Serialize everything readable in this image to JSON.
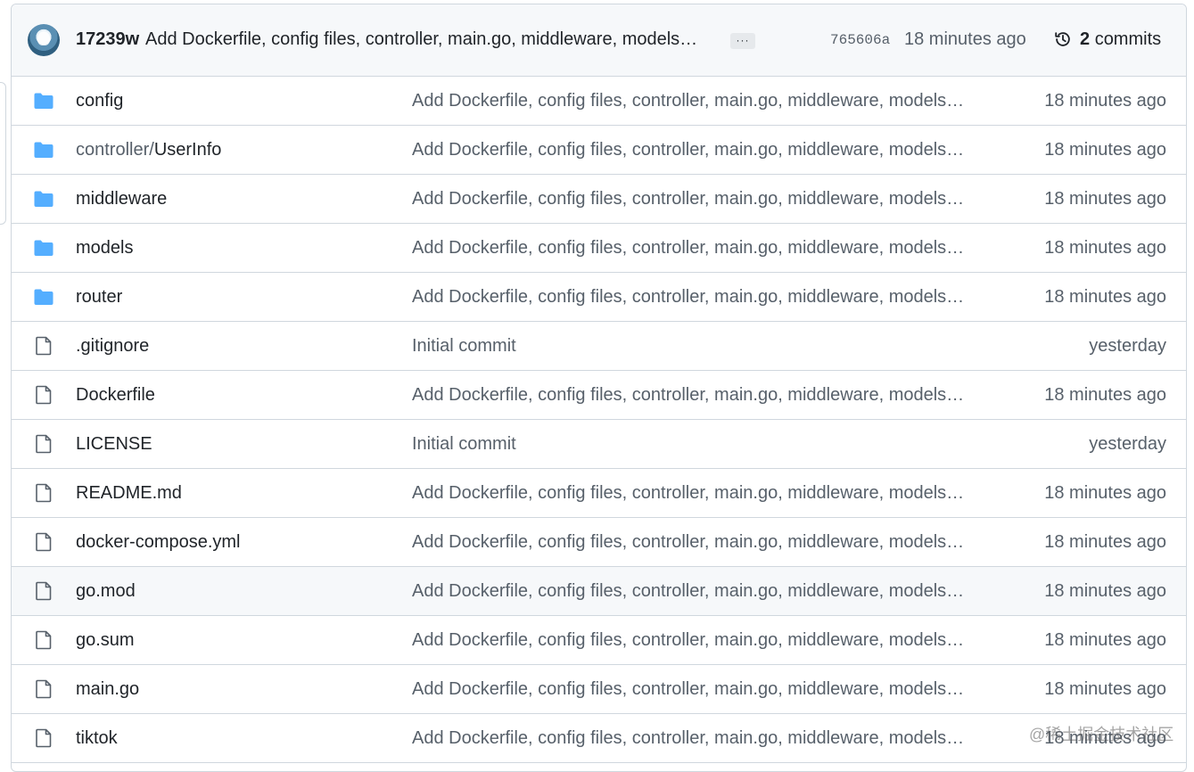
{
  "commit_bar": {
    "author": "17239w",
    "message": "Add Dockerfile, config files, controller, main.go, middleware, models…",
    "ellipsis": "···",
    "sha": "765606a",
    "time": "18 minutes ago",
    "commits_count": "2",
    "commits_label": "commits"
  },
  "files": [
    {
      "type": "folder",
      "prefix": "",
      "name": "config",
      "message": "Add Dockerfile, config files, controller, main.go, middleware, models…",
      "time": "18 minutes ago"
    },
    {
      "type": "folder",
      "prefix": "controller/",
      "name": "UserInfo",
      "message": "Add Dockerfile, config files, controller, main.go, middleware, models…",
      "time": "18 minutes ago"
    },
    {
      "type": "folder",
      "prefix": "",
      "name": "middleware",
      "message": "Add Dockerfile, config files, controller, main.go, middleware, models…",
      "time": "18 minutes ago"
    },
    {
      "type": "folder",
      "prefix": "",
      "name": "models",
      "message": "Add Dockerfile, config files, controller, main.go, middleware, models…",
      "time": "18 minutes ago"
    },
    {
      "type": "folder",
      "prefix": "",
      "name": "router",
      "message": "Add Dockerfile, config files, controller, main.go, middleware, models…",
      "time": "18 minutes ago"
    },
    {
      "type": "file",
      "prefix": "",
      "name": ".gitignore",
      "message": "Initial commit",
      "time": "yesterday"
    },
    {
      "type": "file",
      "prefix": "",
      "name": "Dockerfile",
      "message": "Add Dockerfile, config files, controller, main.go, middleware, models…",
      "time": "18 minutes ago"
    },
    {
      "type": "file",
      "prefix": "",
      "name": "LICENSE",
      "message": "Initial commit",
      "time": "yesterday"
    },
    {
      "type": "file",
      "prefix": "",
      "name": "README.md",
      "message": "Add Dockerfile, config files, controller, main.go, middleware, models…",
      "time": "18 minutes ago"
    },
    {
      "type": "file",
      "prefix": "",
      "name": "docker-compose.yml",
      "message": "Add Dockerfile, config files, controller, main.go, middleware, models…",
      "time": "18 minutes ago"
    },
    {
      "type": "file",
      "prefix": "",
      "name": "go.mod",
      "message": "Add Dockerfile, config files, controller, main.go, middleware, models…",
      "time": "18 minutes ago"
    },
    {
      "type": "file",
      "prefix": "",
      "name": "go.sum",
      "message": "Add Dockerfile, config files, controller, main.go, middleware, models…",
      "time": "18 minutes ago"
    },
    {
      "type": "file",
      "prefix": "",
      "name": "main.go",
      "message": "Add Dockerfile, config files, controller, main.go, middleware, models…",
      "time": "18 minutes ago"
    },
    {
      "type": "file",
      "prefix": "",
      "name": "tiktok",
      "message": "Add Dockerfile, config files, controller, main.go, middleware, models…",
      "time": "18 minutes ago"
    }
  ],
  "watermark": "@稀土掘金技术社区",
  "colors": {
    "folder": "#54aeff",
    "file": "#57606a",
    "muted_text": "#57606a",
    "border": "#d0d7de",
    "header_bg": "#f6f8fa"
  }
}
